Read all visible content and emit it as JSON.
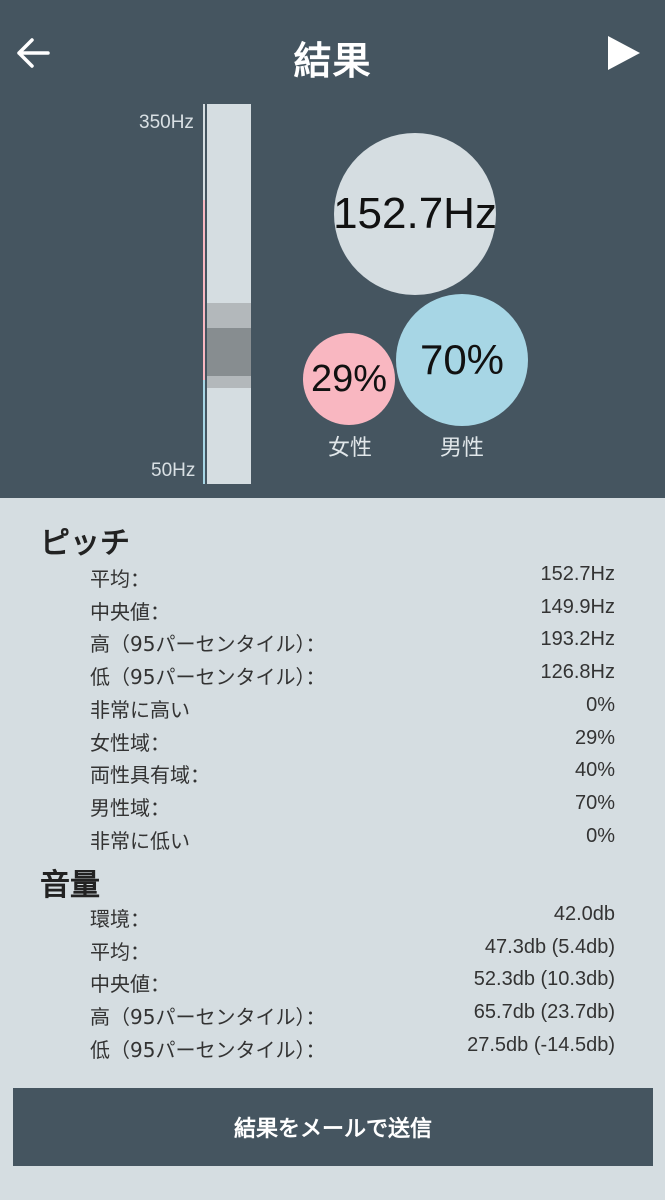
{
  "header": {
    "title": "結果",
    "back_icon": "arrow-left-icon",
    "play_icon": "play-icon"
  },
  "pitch_chart": {
    "axis_top_label": "350Hz",
    "axis_bottom_label": "50Hz",
    "average_value": "152.7Hz",
    "female_percent": "29%",
    "male_percent": "70%",
    "female_label": "女性",
    "male_label": "男性",
    "colors": {
      "female": "#f9b7c1",
      "male": "#a7d6e5",
      "header_bg": "#455560",
      "body_bg": "#d5dde1"
    }
  },
  "pitch": {
    "title": "ピッチ",
    "rows": [
      {
        "label": "平均：",
        "value": "152.7Hz"
      },
      {
        "label": "中央値：",
        "value": "149.9Hz"
      },
      {
        "label": "高（95パーセンタイル）：",
        "value": "193.2Hz"
      },
      {
        "label": "低（95パーセンタイル）：",
        "value": "126.8Hz"
      },
      {
        "label": "非常に高い",
        "value": "0%"
      },
      {
        "label": "女性域：",
        "value": "29%"
      },
      {
        "label": "両性具有域：",
        "value": "40%"
      },
      {
        "label": "男性域：",
        "value": "70%"
      },
      {
        "label": "非常に低い",
        "value": "0%"
      }
    ]
  },
  "volume": {
    "title": "音量",
    "rows": [
      {
        "label": "環境：",
        "value": "42.0db"
      },
      {
        "label": "平均：",
        "value": "47.3db (5.4db)"
      },
      {
        "label": "中央値：",
        "value": "52.3db (10.3db)"
      },
      {
        "label": "高（95パーセンタイル）：",
        "value": "65.7db (23.7db)"
      },
      {
        "label": "低（95パーセンタイル）：",
        "value": "27.5db (-14.5db)"
      }
    ]
  },
  "actions": {
    "send_mail_label": "結果をメールで送信"
  }
}
